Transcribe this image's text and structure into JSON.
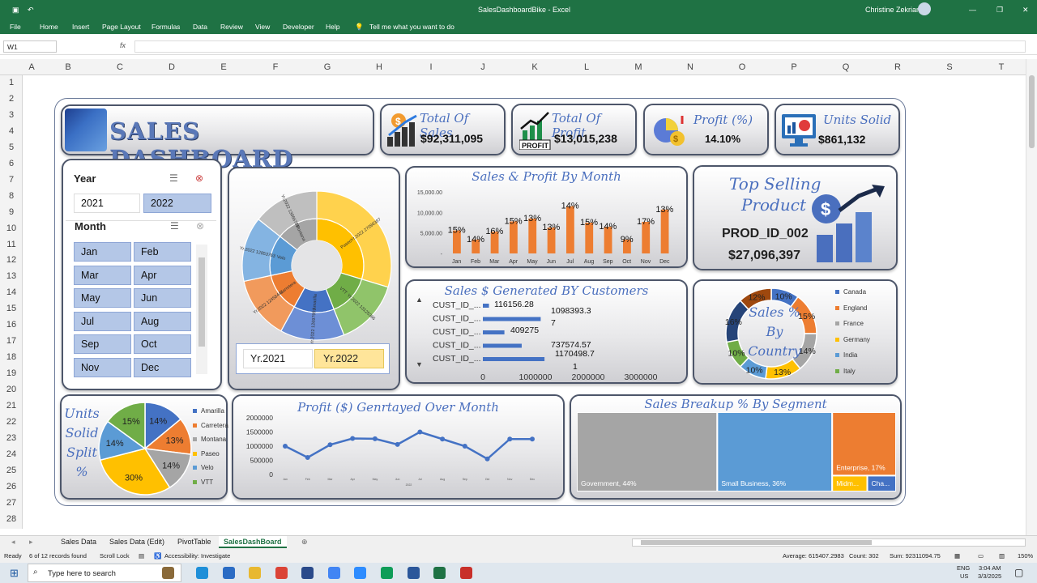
{
  "window": {
    "title": "SalesDashboardBike  -  Excel",
    "user": "Christine Zekrian"
  },
  "ribbon": {
    "tabs": [
      "File",
      "Home",
      "Insert",
      "Page Layout",
      "Formulas",
      "Data",
      "Review",
      "View",
      "Developer",
      "Help"
    ],
    "tell_me": "Tell me what you want to do"
  },
  "formula_bar": {
    "name_box": "W1",
    "fx": "fx"
  },
  "columns": [
    "A",
    "B",
    "C",
    "D",
    "E",
    "F",
    "G",
    "H",
    "I",
    "J",
    "K",
    "L",
    "M",
    "N",
    "O",
    "P",
    "Q",
    "R",
    "S",
    "T"
  ],
  "rows": [
    "1",
    "2",
    "3",
    "4",
    "5",
    "6",
    "7",
    "8",
    "9",
    "10",
    "11",
    "12",
    "13",
    "14",
    "15",
    "16",
    "17",
    "18",
    "19",
    "20",
    "21",
    "22",
    "23",
    "24",
    "25",
    "26",
    "27",
    "28"
  ],
  "dashboard": {
    "title": "SALES DASHBOARD",
    "kpis": [
      {
        "label": "Total Of Sales",
        "value": "$92,311,095",
        "icon": "sales-growth-icon"
      },
      {
        "label": "Total Of Profit",
        "value": "$13,015,238",
        "icon": "profit-chart-icon"
      },
      {
        "label": "Profit (%)",
        "value": "14.10%",
        "icon": "profit-percent-icon"
      },
      {
        "label": "Units Solid",
        "value": "$861,132",
        "icon": "monitor-chart-icon"
      }
    ],
    "year_slicer": {
      "title": "Year",
      "items": [
        "2021",
        "2022"
      ],
      "selected": "2022"
    },
    "month_slicer": {
      "title": "Month",
      "items": [
        "Jan",
        "Feb",
        "Mar",
        "Apr",
        "May",
        "Jun",
        "Jul",
        "Aug",
        "Sep",
        "Oct",
        "Nov",
        "Dec"
      ]
    },
    "year_buttons": [
      "Yr.2021",
      "Yr.2022"
    ],
    "top_product": {
      "title_line1": "Top Selling",
      "title_line2": "Product",
      "id": "PROD_ID_002",
      "value": "$27,096,397"
    },
    "customer_rows": [
      "CUST_ID_...",
      "CUST_ID_...",
      "CUST_ID_...",
      "CUST_ID_...",
      "CUST_ID_..."
    ]
  },
  "sunburst_labels": [
    {
      "text": "Paseo"
    },
    {
      "text": "Yr.2022 27096397"
    },
    {
      "text": "VTT"
    },
    {
      "text": "Yr.2022 13125366"
    },
    {
      "text": "Amarilla"
    },
    {
      "text": "Yr.2022 12697991"
    },
    {
      "text": "Carretera"
    },
    {
      "text": "Yr.2022 12458444"
    },
    {
      "text": "Velo"
    },
    {
      "text": "Yr.2022 12853763"
    },
    {
      "text": "Montana"
    },
    {
      "text": "Yr.2022 13066787"
    }
  ],
  "chart_data": [
    {
      "type": "bar",
      "title": "Sales & Profit By Month",
      "categories": [
        "Jan",
        "Feb",
        "Mar",
        "Apr",
        "May",
        "Jun",
        "Jul",
        "Aug",
        "Sep",
        "Oct",
        "Nov",
        "Dec"
      ],
      "values": [
        5600,
        3400,
        5300,
        7800,
        8500,
        6300,
        11500,
        7500,
        6500,
        3400,
        7700,
        10700
      ],
      "labels": [
        "15%",
        "14%",
        "16%",
        "15%",
        "13%",
        "13%",
        "14%",
        "15%",
        "14%",
        "9%",
        "17%",
        "13%"
      ],
      "yticks": [
        "15,000.00",
        "10,000.00",
        "5,000.00",
        "-"
      ],
      "ylim": [
        0,
        15000
      ],
      "color": "#ed7d31"
    },
    {
      "type": "bar",
      "title": "Sales $ Generated BY Customers",
      "categories": [
        "CUST_ID_...",
        "CUST_ID_...",
        "CUST_ID_...",
        "CUST_ID_...",
        "CUST_ID_..."
      ],
      "values": [
        116156.28,
        1098393.37,
        409275,
        737574.57,
        1170498.71
      ],
      "labels": [
        "116156.28",
        "1098393.3",
        "7",
        "409275",
        "737574.57",
        "1170498.7",
        "1"
      ],
      "xticks": [
        "0",
        "1000000",
        "2000000",
        "3000000"
      ],
      "xlim": [
        0,
        3000000
      ],
      "color": "#4472c4"
    },
    {
      "type": "pie",
      "title": "Sales % By Country",
      "categories": [
        "Canada",
        "England",
        "France",
        "Germany",
        "India",
        "Italy"
      ],
      "values": [
        10,
        15,
        14,
        13,
        10,
        10,
        16,
        12
      ],
      "labels": [
        "10%",
        "15%",
        "14%",
        "13%",
        "10%",
        "10%",
        "16%",
        "12%"
      ],
      "colors": [
        "#4472c4",
        "#ed7d31",
        "#a5a5a5",
        "#ffc000",
        "#5b9bd5",
        "#70ad47",
        "#264478",
        "#9e480e"
      ]
    },
    {
      "type": "pie",
      "title": "Units Solid Split %",
      "categories": [
        "Amarilla",
        "Carretera",
        "Montana",
        "Paseo",
        "Velo",
        "VTT"
      ],
      "values": [
        14,
        13,
        14,
        30,
        14,
        15
      ],
      "labels": [
        "14%",
        "13%",
        "14%",
        "30%",
        "14%",
        "15%"
      ],
      "colors": [
        "#4472c4",
        "#ed7d31",
        "#a5a5a5",
        "#ffc000",
        "#5b9bd5",
        "#70ad47"
      ]
    },
    {
      "type": "line",
      "title": "Profit ($) Genrtayed Over Month",
      "values": [
        1000000,
        600000,
        1050000,
        1270000,
        1260000,
        1060000,
        1500000,
        1250000,
        1000000,
        550000,
        1250000,
        1250000
      ],
      "yticks": [
        "2000000",
        "1500000",
        "1000000",
        "500000",
        "0"
      ],
      "ylim": [
        0,
        2000000
      ],
      "xlabels": [
        "Jan",
        "Feb",
        "Mar",
        "Apr",
        "May",
        "Jun",
        "Jul",
        "Aug",
        "Sep",
        "Oct",
        "Nov",
        "Dec"
      ],
      "xaxis_label": "2022",
      "color": "#4472c4"
    },
    {
      "type": "table",
      "title": "Sales Breakup % By Segment",
      "segments": [
        {
          "label": "Government, 44%",
          "value": 44,
          "color": "#a5a5a5"
        },
        {
          "label": "Small Business, 36%",
          "value": 36,
          "color": "#5b9bd5"
        },
        {
          "label": "Enterprise, 17%",
          "value": 17,
          "color": "#ed7d31"
        },
        {
          "label": "Midm...",
          "value": 2,
          "color": "#ffc000"
        },
        {
          "label": "Cha...",
          "value": 1,
          "color": "#4472c4"
        }
      ]
    }
  ],
  "sheets": [
    "Sales Data",
    "Sales Data (Edit)",
    "PivotTable",
    "SalesDashBoard"
  ],
  "status": {
    "ready": "Ready",
    "records": "6 of 12 records found",
    "scroll": "Scroll Lock",
    "access": "Accessibility: Investigate",
    "average": "Average: 615407.2983",
    "count": "Count: 302",
    "sum": "Sum: 92311094.75",
    "zoom": "150%"
  },
  "taskbar": {
    "search": "Type here to search",
    "lang": "ENG",
    "region": "US",
    "time": "3:04 AM",
    "date": "3/3/2025"
  }
}
